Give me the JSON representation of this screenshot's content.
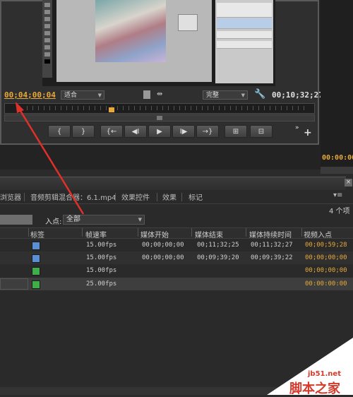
{
  "monitor": {
    "timecode_current": "00;04;00;04",
    "fit_select": "适合",
    "quality_select": "完整",
    "timecode_duration": "00;10;32;27",
    "timecode_right_panel": "00:00:00"
  },
  "transport": {
    "mark_in": "{",
    "mark_out": "}",
    "go_to_in": "{←",
    "step_back": "◀I",
    "play": "▶",
    "step_forward": "I▶",
    "go_to_out": "→}",
    "more": "»",
    "add": "+"
  },
  "panel": {
    "tabs": [
      "浏览器",
      "音频剪辑混合器：6.1.mp4",
      "效果控件",
      "效果",
      "标记"
    ],
    "menu_icon": "▾≡",
    "close_icon": "×",
    "item_count": "4 个项",
    "inpoint_label": "入点:",
    "inpoint_value": "全部",
    "columns": [
      "标签",
      "帧速率",
      "媒体开始",
      "媒体结束",
      "媒体持续时间",
      "视频入点"
    ]
  },
  "rows": [
    {
      "label_color": "#5b8fd4",
      "frame_rate": "15.00fps",
      "media_start": "00;00;00;00",
      "media_end": "00;11;32;25",
      "duration": "00;11;32;27",
      "video_in": "00;00;59;28"
    },
    {
      "label_color": "#5b8fd4",
      "frame_rate": "15.00fps",
      "media_start": "00;00;00;00",
      "media_end": "00;09;39;20",
      "duration": "00;09;39;22",
      "video_in": "00;00;00;00"
    },
    {
      "label_color": "#3fae49",
      "frame_rate": "15.00fps",
      "media_start": "",
      "media_end": "",
      "duration": "",
      "video_in": "00;00;00;00"
    },
    {
      "label_color": "#3fae49",
      "frame_rate": "25.00fps",
      "media_start": "",
      "media_end": "",
      "duration": "",
      "video_in": "00:00:00:00"
    }
  ],
  "watermark": {
    "site": "jb51.net",
    "brand": "脚本之家"
  },
  "colors": {
    "timecode_accent": "#e8a93a",
    "arrow": "#e0302a"
  }
}
